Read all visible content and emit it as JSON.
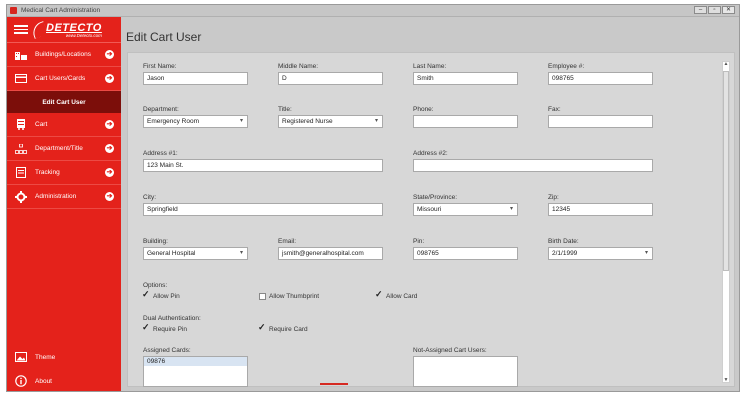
{
  "window": {
    "title": "Medical Cart Administration"
  },
  "sidebar": {
    "logo": {
      "brand": "DETECTO",
      "url": "www.Detecto.com"
    },
    "items": [
      {
        "label": "Buildings/Locations"
      },
      {
        "label": "Cart Users/Cards"
      },
      {
        "label": "Edit Cart User"
      },
      {
        "label": "Cart"
      },
      {
        "label": "Department/Title"
      },
      {
        "label": "Tracking"
      },
      {
        "label": "Administration"
      }
    ],
    "bottom": [
      {
        "label": "Theme"
      },
      {
        "label": "About"
      }
    ]
  },
  "page": {
    "title": "Edit Cart User"
  },
  "form": {
    "first_name": {
      "label": "First Name:",
      "value": "Jason"
    },
    "middle_name": {
      "label": "Middle Name:",
      "value": "D"
    },
    "last_name": {
      "label": "Last Name:",
      "value": "Smith"
    },
    "employee": {
      "label": "Employee #:",
      "value": "098765"
    },
    "department": {
      "label": "Department:",
      "value": "Emergency Room"
    },
    "title": {
      "label": "Title:",
      "value": "Registered Nurse"
    },
    "phone": {
      "label": "Phone:",
      "value": ""
    },
    "fax": {
      "label": "Fax:",
      "value": ""
    },
    "address1": {
      "label": "Address #1:",
      "value": "123 Main St."
    },
    "address2": {
      "label": "Address #2:",
      "value": ""
    },
    "city": {
      "label": "City:",
      "value": "Springfield"
    },
    "state": {
      "label": "State/Province:",
      "value": "Missouri"
    },
    "zip": {
      "label": "Zip:",
      "value": "12345"
    },
    "building": {
      "label": "Building:",
      "value": "General Hospital"
    },
    "email": {
      "label": "Email:",
      "value": "jsmith@generalhospital.com"
    },
    "pin": {
      "label": "Pin:",
      "value": "098765"
    },
    "birth_date": {
      "label": "Birth Date:",
      "value": "2/1/1999"
    },
    "options": {
      "label": "Options:",
      "allow_pin": {
        "label": "Allow Pin",
        "checked": true
      },
      "allow_thumbprint": {
        "label": "Allow Thumbprint",
        "checked": false
      },
      "allow_card": {
        "label": "Allow Card",
        "checked": true
      }
    },
    "dual_auth": {
      "label": "Dual Authentication:",
      "require_pin": {
        "label": "Require Pin",
        "checked": true
      },
      "require_card": {
        "label": "Require Card",
        "checked": true
      }
    },
    "assigned_cards": {
      "label": "Assigned Cards:",
      "items": [
        "09876"
      ]
    },
    "not_assigned": {
      "label": "Not-Assigned Cart Users:",
      "items": []
    }
  },
  "colors": {
    "sidebar": "#e4221b",
    "active_item": "#7c0e0a",
    "accent_line": "#d62a22"
  }
}
